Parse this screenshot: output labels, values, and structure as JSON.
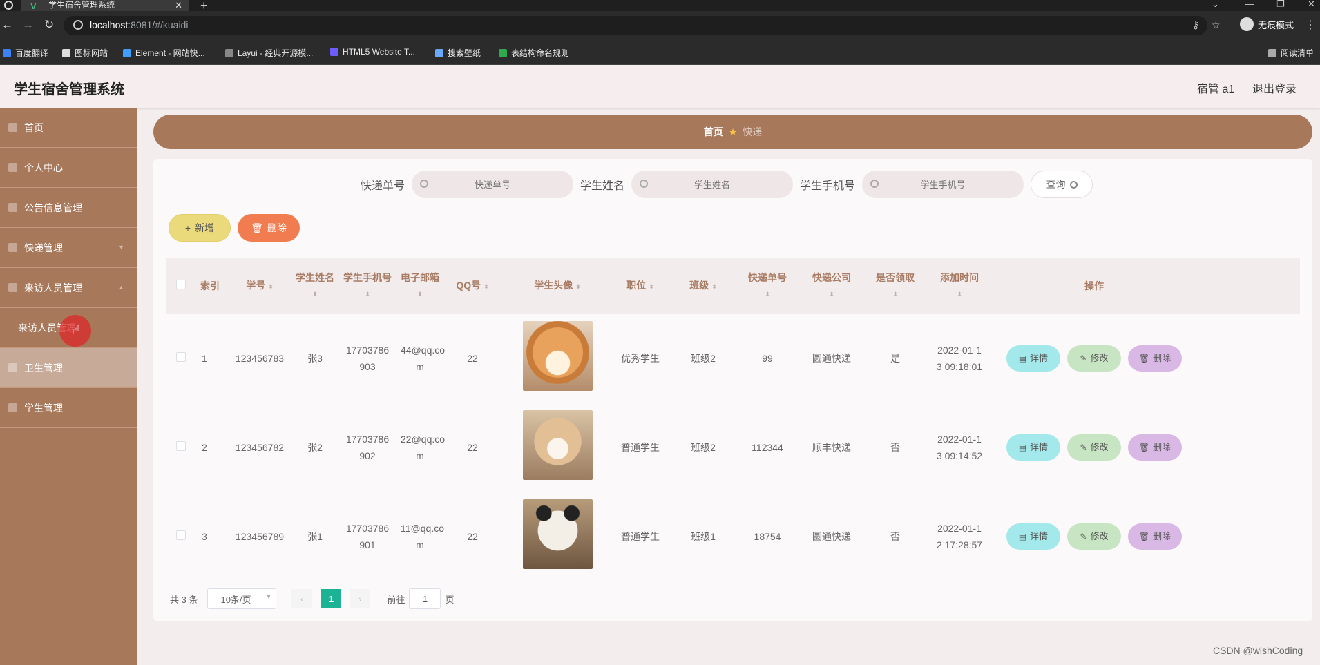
{
  "browser": {
    "tab_title": "学生宿舍管理系统",
    "url_host": "localhost",
    "url_rest": ":8081/#/kuaidi",
    "incognito_label": "无痕模式",
    "bookmarks": [
      "百度翻译",
      "图标网站",
      "Element - 网站快...",
      "Layui - 经典开源模...",
      "HTML5 Website T...",
      "搜索壁纸",
      "表结构命名规则"
    ],
    "reading_list": "阅读清单"
  },
  "header": {
    "app_title": "学生宿舍管理系统",
    "user": "宿管 a1",
    "logout": "退出登录"
  },
  "sidebar": {
    "items": [
      {
        "label": "首页"
      },
      {
        "label": "个人中心"
      },
      {
        "label": "公告信息管理"
      },
      {
        "label": "快递管理"
      },
      {
        "label": "来访人员管理"
      },
      {
        "label": "来访人员管理"
      },
      {
        "label": "卫生管理"
      },
      {
        "label": "学生管理"
      }
    ]
  },
  "breadcrumb": {
    "home": "首页",
    "current": "快递"
  },
  "search": {
    "f1_label": "快递单号",
    "f1_placeholder": "快递单号",
    "f2_label": "学生姓名",
    "f2_placeholder": "学生姓名",
    "f3_label": "学生手机号",
    "f3_placeholder": "学生手机号",
    "query": "查询"
  },
  "actions": {
    "add": "新增",
    "delete": "删除"
  },
  "table": {
    "headers": [
      "索引",
      "学号",
      "学生姓名",
      "学生手机号",
      "电子邮箱",
      "QQ号",
      "学生头像",
      "职位",
      "班级",
      "快递单号",
      "快递公司",
      "是否领取",
      "添加时间",
      "操作"
    ],
    "rows": [
      {
        "idx": "1",
        "sno": "123456783",
        "name": "张3",
        "phone1": "17703786",
        "phone2": "903",
        "email1": "44@qq.co",
        "email2": "m",
        "qq": "22",
        "role": "优秀学生",
        "cls": "班级2",
        "exno": "99",
        "company": "圆通快递",
        "taken": "是",
        "time1": "2022-01-1",
        "time2": "3 09:18:01"
      },
      {
        "idx": "2",
        "sno": "123456782",
        "name": "张2",
        "phone1": "17703786",
        "phone2": "902",
        "email1": "22@qq.co",
        "email2": "m",
        "qq": "22",
        "role": "普通学生",
        "cls": "班级2",
        "exno": "112344",
        "company": "顺丰快递",
        "taken": "否",
        "time1": "2022-01-1",
        "time2": "3 09:14:52"
      },
      {
        "idx": "3",
        "sno": "123456789",
        "name": "张1",
        "phone1": "17703786",
        "phone2": "901",
        "email1": "11@qq.co",
        "email2": "m",
        "qq": "22",
        "role": "普通学生",
        "cls": "班级1",
        "exno": "18754",
        "company": "圆通快递",
        "taken": "否",
        "time1": "2022-01-1",
        "time2": "2 17:28:57"
      }
    ],
    "op_detail": "详情",
    "op_edit": "修改",
    "op_delete": "删除"
  },
  "pagination": {
    "total": "共 3 条",
    "page_size": "10条/页",
    "current": "1",
    "goto_label": "前往",
    "goto_value": "1",
    "page_suffix": "页"
  },
  "watermark": "CSDN @wishCoding",
  "colors": {
    "accent": "#a8785b",
    "page_active": "#1bb394"
  }
}
